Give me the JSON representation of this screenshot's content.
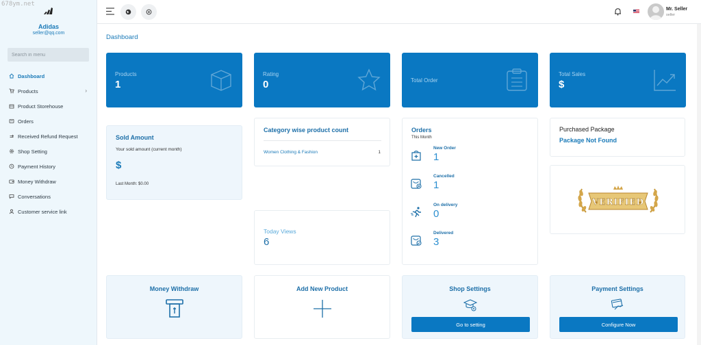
{
  "watermark": "678ym.net",
  "sidebar": {
    "brand_name": "Adidas",
    "brand_email": "seller@qq.com",
    "search_placeholder": "Search in menu",
    "items": [
      {
        "label": "Dashboard",
        "icon": "home-icon",
        "active": true
      },
      {
        "label": "Products",
        "icon": "cart-icon"
      },
      {
        "label": "Product Storehouse",
        "icon": "storehouse-icon"
      },
      {
        "label": "Orders",
        "icon": "orders-icon"
      },
      {
        "label": "Received Refund Request",
        "icon": "refund-icon"
      },
      {
        "label": "Shop Setting",
        "icon": "gear-icon"
      },
      {
        "label": "Payment History",
        "icon": "history-icon"
      },
      {
        "label": "Money Withdraw",
        "icon": "wallet-icon"
      },
      {
        "label": "Conversations",
        "icon": "chat-icon"
      },
      {
        "label": "Customer service link",
        "icon": "user-icon"
      }
    ]
  },
  "topbar": {
    "user_name": "Mr. Seller",
    "user_role": "seller"
  },
  "main": {
    "page_title": "Dashboard",
    "stats": {
      "products": {
        "label": "Products",
        "value": "1"
      },
      "rating": {
        "label": "Rating",
        "value": "0"
      },
      "total_order": {
        "label": "Total Order"
      },
      "total_sales": {
        "label": "Total Sales",
        "value": "$"
      }
    },
    "sold_amount": {
      "title": "Sold Amount",
      "subtitle": "Your sold amount (current month)",
      "value": "$",
      "last_month": "Last Month: $0.00"
    },
    "category": {
      "title": "Category wise product count",
      "rows": [
        {
          "name": "Women Clothing & Fashion",
          "count": "1"
        }
      ]
    },
    "today_views": {
      "label": "Today Views",
      "value": "6"
    },
    "orders": {
      "title": "Orders",
      "subtitle": "This Month",
      "rows": [
        {
          "label": "New Order",
          "value": "1"
        },
        {
          "label": "Cancelled",
          "value": "1"
        },
        {
          "label": "On delivery",
          "value": "0"
        },
        {
          "label": "Delivered",
          "value": "3"
        }
      ]
    },
    "package": {
      "title": "Purchased Package",
      "status": "Package Not Found",
      "badge_text": "VERIFIED"
    },
    "actions": {
      "money_withdraw": {
        "title": "Money Withdraw"
      },
      "add_product": {
        "title": "Add New Product"
      },
      "shop_settings": {
        "title": "Shop Settings",
        "button": "Go to setting"
      },
      "payment_settings": {
        "title": "Payment Settings",
        "button": "Configure Now"
      }
    }
  }
}
